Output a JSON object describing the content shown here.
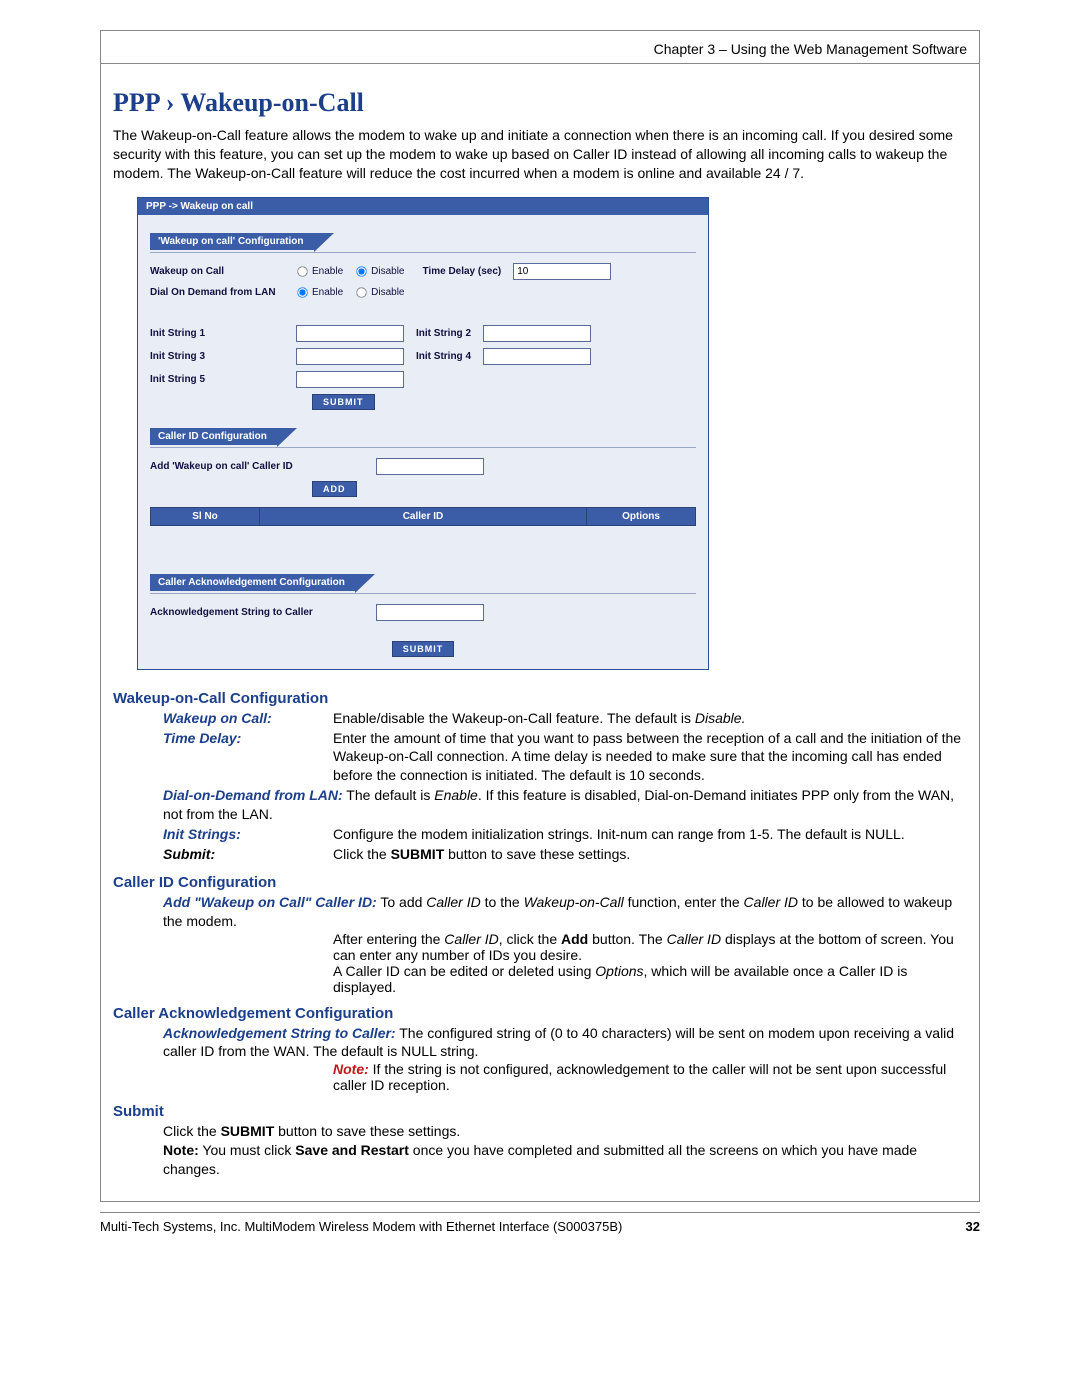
{
  "header": {
    "chapter": "Chapter 3 – Using the Web Management Software"
  },
  "title": "PPP › Wakeup-on-Call",
  "intro": "The Wakeup-on-Call feature allows the modem to wake up and initiate a connection when there is an incoming call. If you desired some security with this feature, you can set up the modem to wake up based on Caller ID instead of allowing all incoming calls to wakeup the modem. The Wakeup-on-Call feature will reduce the cost incurred when a modem is online and available 24 / 7.",
  "ui": {
    "breadcrumb": "PPP  ->  Wakeup on call",
    "sec1": {
      "title": "'Wakeup on call' Configuration",
      "wakeup_label": "Wakeup on Call",
      "enable": "Enable",
      "disable": "Disable",
      "time_delay_label": "Time Delay (sec)",
      "time_delay_value": "10",
      "dod_label": "Dial On Demand from LAN",
      "init1": "Init String 1",
      "init2": "Init String 2",
      "init3": "Init String 3",
      "init4": "Init String 4",
      "init5": "Init String 5",
      "submit": "SUBMIT"
    },
    "sec2": {
      "title": "Caller ID Configuration",
      "add_label": "Add 'Wakeup on call' Caller ID",
      "add_btn": "ADD",
      "th_slno": "Sl No",
      "th_caller": "Caller ID",
      "th_options": "Options"
    },
    "sec3": {
      "title": "Caller Acknowledgement Configuration",
      "ack_label": "Acknowledgement String to Caller",
      "submit": "SUBMIT"
    }
  },
  "doc": {
    "s1_h": "Wakeup-on-Call Configuration",
    "wakeup_term": "Wakeup on Call:",
    "wakeup_body_a": "Enable/disable the Wakeup-on-Call feature. The default is ",
    "wakeup_body_b": "Disable.",
    "timedelay_term": "Time Delay:",
    "timedelay_body": "Enter the amount of time that you want to pass between the reception of a call and the initiation of the Wakeup-on-Call connection. A time delay is needed to make sure that the incoming call has ended before the connection is initiated. The default is 10 seconds.",
    "dod_term": "Dial-on-Demand from LAN:",
    "dod_body_a": " The default is ",
    "dod_body_b": "Enable",
    "dod_body_c": ". If this feature is disabled, Dial-on-Demand initiates PPP only from the WAN, not from the LAN.",
    "init_term": "Init Strings:",
    "init_body": "Configure the modem initialization strings. Init-num can range from 1-5. The default is NULL.",
    "submit_term": "Submit:",
    "submit1_body_a": "Click the ",
    "submit1_body_b": "SUBMIT",
    "submit1_body_c": " button to save these settings.",
    "s2_h": "Caller ID Configuration",
    "add_term": "Add \"Wakeup on Call\" Caller ID:",
    "add_body_a": "  To add ",
    "add_body_b": "Caller ID",
    "add_body_c": " to the ",
    "add_body_d": "Wakeup-on-Call",
    "add_body_e": " function, enter the ",
    "add_body_f": "Caller ID",
    "add_body_g": " to be allowed to wakeup the modem.",
    "add_p2_a": "After entering the ",
    "add_p2_b": "Caller ID",
    "add_p2_c": ", click the ",
    "add_p2_d": "Add",
    "add_p2_e": " button. The ",
    "add_p2_f": "Caller ID",
    "add_p2_g": " displays at the bottom of screen. You can enter any number of IDs you desire.",
    "add_p3_a": "A Caller ID can be edited or deleted using ",
    "add_p3_b": "Options",
    "add_p3_c": ", which will be available once a Caller ID is displayed.",
    "s3_h": "Caller Acknowledgement Configuration",
    "ack_term": "Acknowledgement String to Caller:",
    "ack_body": " The configured string of (0 to 40 characters) will be sent on modem upon receiving a valid caller ID from the WAN. The default is NULL string.",
    "ack_note_lbl": "Note:",
    "ack_note_body": " If the string is not configured, acknowledgement to the caller will not be sent upon successful caller ID reception.",
    "s4_h": "Submit",
    "s4_l1_a": "Click the ",
    "s4_l1_b": "SUBMIT",
    "s4_l1_c": " button to save these settings.",
    "s4_note_lbl": "Note:",
    "s4_note_a": " You must click ",
    "s4_note_b": "Save and Restart",
    "s4_note_c": " once you have completed and submitted all the screens on which you have made changes."
  },
  "footer": {
    "text": "Multi-Tech Systems, Inc. MultiModem Wireless Modem with Ethernet Interface (S000375B)",
    "page": "32"
  }
}
